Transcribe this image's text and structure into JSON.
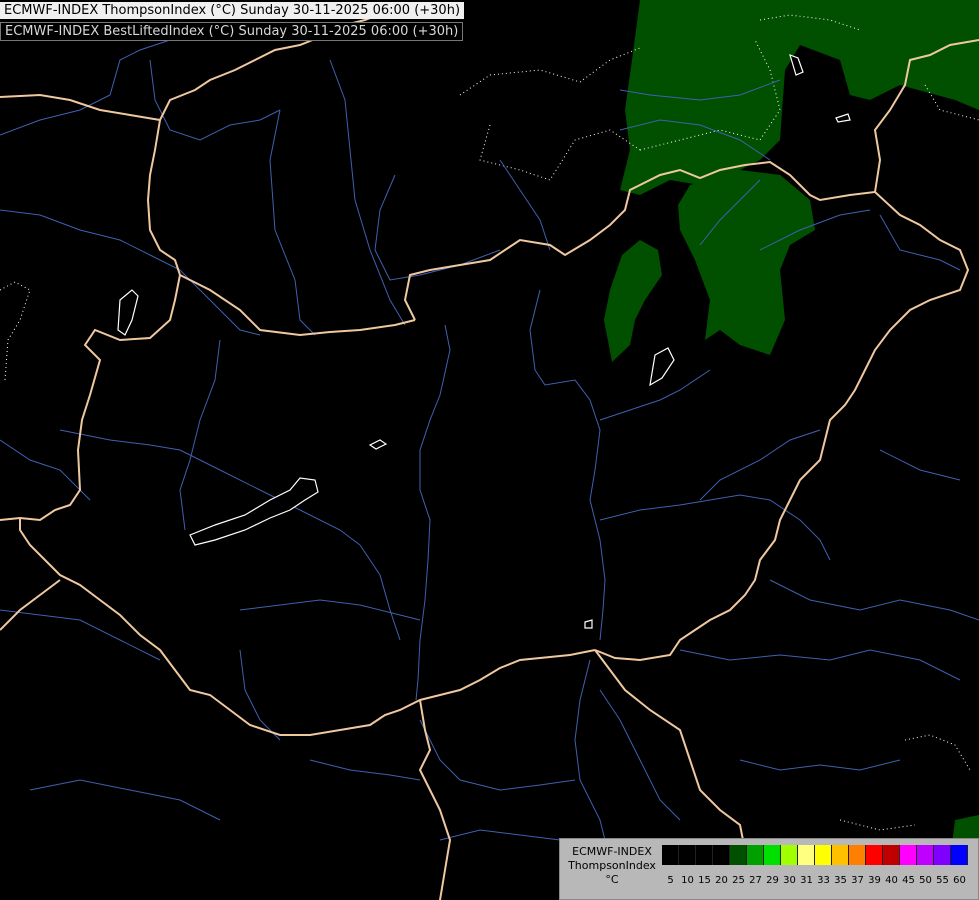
{
  "header": {
    "line1": "ECMWF-INDEX ThompsonIndex (°C) Sunday 30-11-2025 06:00 (+30h)",
    "line2": "ECMWF-INDEX BestLiftedIndex (°C) Sunday 30-11-2025 06:00 (+30h)"
  },
  "legend": {
    "line1": "ECMWF-INDEX",
    "line2": "ThompsonIndex",
    "line3": "°C",
    "colors": [
      "#000000",
      "#000000",
      "#000000",
      "#000000",
      "#005000",
      "#00a000",
      "#00e000",
      "#a0ff00",
      "#ffff80",
      "#ffff00",
      "#ffc000",
      "#ff8000",
      "#ff0000",
      "#c00000",
      "#ff00ff",
      "#c000ff",
      "#8000ff",
      "#0000ff"
    ],
    "ticks": [
      "5",
      "10",
      "15",
      "20",
      "25",
      "27",
      "29",
      "30",
      "31",
      "33",
      "35",
      "37",
      "39",
      "40",
      "45",
      "50",
      "55",
      "60"
    ]
  },
  "colors": {
    "border": "#f0c8a0",
    "river": "#4060b0",
    "positive_area": "#005000",
    "lake_outline": "#ffffff"
  }
}
